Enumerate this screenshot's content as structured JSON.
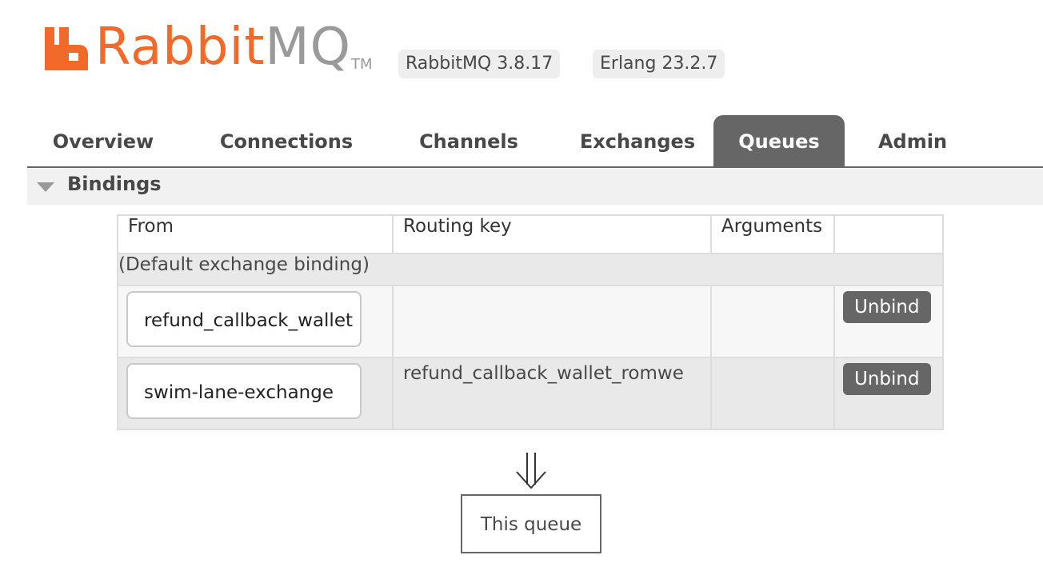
{
  "header": {
    "logo_rabbit": "Rabbit",
    "logo_mq": "MQ",
    "logo_tm": "TM",
    "rabbitmq_version": "RabbitMQ 3.8.17",
    "erlang_version": "Erlang 23.2.7",
    "brand_color": "#f26a29"
  },
  "tabs": [
    {
      "label": "Overview"
    },
    {
      "label": "Connections"
    },
    {
      "label": "Channels"
    },
    {
      "label": "Exchanges"
    },
    {
      "label": "Queues",
      "active": true
    },
    {
      "label": "Admin"
    }
  ],
  "section": {
    "title": "Bindings",
    "icon": "triangle-down-icon"
  },
  "bindings_table": {
    "columns": [
      "From",
      "Routing key",
      "Arguments",
      ""
    ],
    "group_label": "(Default exchange binding)",
    "rows": [
      {
        "from": "refund_callback_wallet",
        "routing_key": "",
        "arguments": "",
        "action": "Unbind"
      },
      {
        "from": "swim-lane-exchange",
        "routing_key": "refund_callback_wallet_romwe",
        "arguments": "",
        "action": "Unbind"
      }
    ]
  },
  "footer": {
    "arrow_icon": "double-down-arrow-icon",
    "queue_label": "This queue"
  }
}
